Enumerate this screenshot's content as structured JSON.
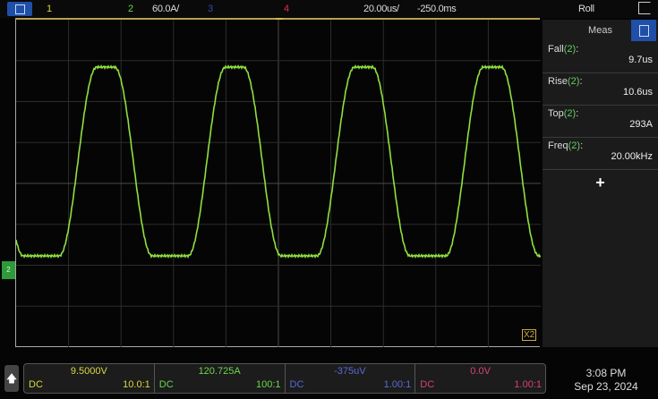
{
  "topbar": {
    "ch1": "1",
    "ch2": "2",
    "ch2_scale": "60.0A/",
    "ch3": "3",
    "ch4": "4",
    "timebase": "20.00us/",
    "delay": "-250.0ms",
    "mode": "Roll"
  },
  "meas": {
    "title": "Meas",
    "items": [
      {
        "name": "Fall",
        "ch": "(2)",
        "suffix": ":",
        "value": "9.7us"
      },
      {
        "name": "Rise",
        "ch": "(2)",
        "suffix": ":",
        "value": "10.6us"
      },
      {
        "name": "Top",
        "ch": "(2)",
        "suffix": ":",
        "value": "293A"
      },
      {
        "name": "Freq",
        "ch": "(2)",
        "suffix": ":",
        "value": "20.00kHz"
      }
    ],
    "add": "+"
  },
  "channels": [
    {
      "value": "9.5000V",
      "coupling": "DC",
      "probe": "10.0:1",
      "color": "#d8d840"
    },
    {
      "value": "120.725A",
      "coupling": "DC",
      "probe": "100:1",
      "color": "#6ad84a"
    },
    {
      "value": "-375uV",
      "coupling": "DC",
      "probe": "1.00:1",
      "color": "#5a6ad8"
    },
    {
      "value": "0.0V",
      "coupling": "DC",
      "probe": "1.00:1",
      "color": "#d8407a"
    }
  ],
  "clock": {
    "time": "3:08 PM",
    "date": "Sep 23, 2024"
  },
  "ground_marker": "2",
  "zoom_marker": "X2",
  "trace": {
    "channel": "2",
    "color": "#8fe040",
    "frequency_khz": 20
  }
}
